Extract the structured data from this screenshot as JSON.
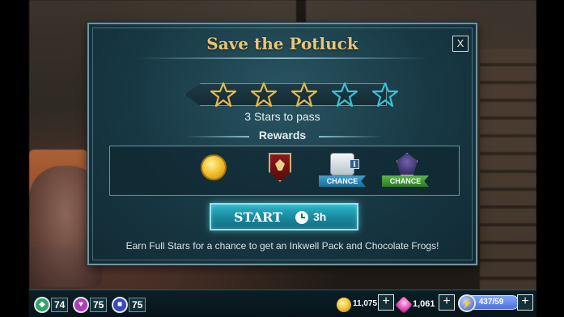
{
  "dialog": {
    "title": "Save the Potluck",
    "close_label": "X",
    "stars": {
      "required": 3,
      "total": 5,
      "required_color": "#e8b84a",
      "extra_color": "#39c2d3"
    },
    "pass_text": "3 Stars to pass",
    "rewards_label": "Rewards",
    "rewards": [
      {
        "name": "coin-icon",
        "chance": ""
      },
      {
        "name": "house-crest-icon",
        "chance": ""
      },
      {
        "name": "inkwell-pack-icon",
        "chance": "CHANCE",
        "info": "i"
      },
      {
        "name": "chocolate-frog-card-icon",
        "chance": "CHANCE"
      }
    ],
    "start": {
      "label": "START",
      "time": "3h"
    },
    "footer": "Earn Full Stars for a chance to get an Inkwell Pack and Chocolate Frogs!"
  },
  "hud": {
    "stats": [
      {
        "icon": "shield-icon",
        "value": "74",
        "color": "#2fa36b"
      },
      {
        "icon": "heart-icon",
        "value": "75",
        "color": "#b03cb8"
      },
      {
        "icon": "book-icon",
        "value": "75",
        "color": "#3a49b5"
      }
    ],
    "coins": "11,075",
    "gems": "1,061",
    "energy": "437/59"
  },
  "colors": {
    "panel": "#1d4a57",
    "gold_title": "#e8c676",
    "button": "#1a8aa0"
  }
}
